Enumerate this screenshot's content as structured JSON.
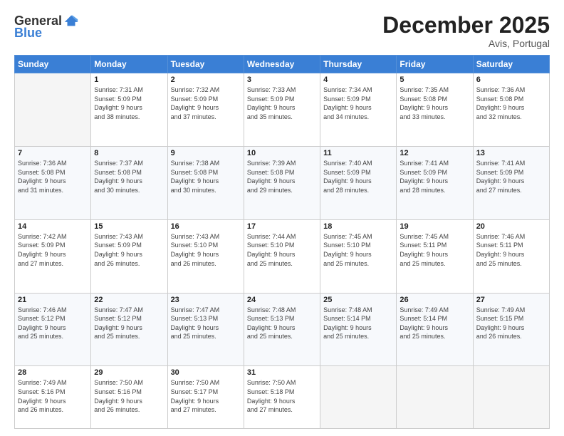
{
  "header": {
    "logo_line1": "General",
    "logo_line2": "Blue",
    "month_title": "December 2025",
    "location": "Avis, Portugal"
  },
  "days_of_week": [
    "Sunday",
    "Monday",
    "Tuesday",
    "Wednesday",
    "Thursday",
    "Friday",
    "Saturday"
  ],
  "weeks": [
    [
      {
        "day": "",
        "info": ""
      },
      {
        "day": "1",
        "info": "Sunrise: 7:31 AM\nSunset: 5:09 PM\nDaylight: 9 hours\nand 38 minutes."
      },
      {
        "day": "2",
        "info": "Sunrise: 7:32 AM\nSunset: 5:09 PM\nDaylight: 9 hours\nand 37 minutes."
      },
      {
        "day": "3",
        "info": "Sunrise: 7:33 AM\nSunset: 5:09 PM\nDaylight: 9 hours\nand 35 minutes."
      },
      {
        "day": "4",
        "info": "Sunrise: 7:34 AM\nSunset: 5:09 PM\nDaylight: 9 hours\nand 34 minutes."
      },
      {
        "day": "5",
        "info": "Sunrise: 7:35 AM\nSunset: 5:08 PM\nDaylight: 9 hours\nand 33 minutes."
      },
      {
        "day": "6",
        "info": "Sunrise: 7:36 AM\nSunset: 5:08 PM\nDaylight: 9 hours\nand 32 minutes."
      }
    ],
    [
      {
        "day": "7",
        "info": "Sunrise: 7:36 AM\nSunset: 5:08 PM\nDaylight: 9 hours\nand 31 minutes."
      },
      {
        "day": "8",
        "info": "Sunrise: 7:37 AM\nSunset: 5:08 PM\nDaylight: 9 hours\nand 30 minutes."
      },
      {
        "day": "9",
        "info": "Sunrise: 7:38 AM\nSunset: 5:08 PM\nDaylight: 9 hours\nand 30 minutes."
      },
      {
        "day": "10",
        "info": "Sunrise: 7:39 AM\nSunset: 5:08 PM\nDaylight: 9 hours\nand 29 minutes."
      },
      {
        "day": "11",
        "info": "Sunrise: 7:40 AM\nSunset: 5:09 PM\nDaylight: 9 hours\nand 28 minutes."
      },
      {
        "day": "12",
        "info": "Sunrise: 7:41 AM\nSunset: 5:09 PM\nDaylight: 9 hours\nand 28 minutes."
      },
      {
        "day": "13",
        "info": "Sunrise: 7:41 AM\nSunset: 5:09 PM\nDaylight: 9 hours\nand 27 minutes."
      }
    ],
    [
      {
        "day": "14",
        "info": "Sunrise: 7:42 AM\nSunset: 5:09 PM\nDaylight: 9 hours\nand 27 minutes."
      },
      {
        "day": "15",
        "info": "Sunrise: 7:43 AM\nSunset: 5:09 PM\nDaylight: 9 hours\nand 26 minutes."
      },
      {
        "day": "16",
        "info": "Sunrise: 7:43 AM\nSunset: 5:10 PM\nDaylight: 9 hours\nand 26 minutes."
      },
      {
        "day": "17",
        "info": "Sunrise: 7:44 AM\nSunset: 5:10 PM\nDaylight: 9 hours\nand 25 minutes."
      },
      {
        "day": "18",
        "info": "Sunrise: 7:45 AM\nSunset: 5:10 PM\nDaylight: 9 hours\nand 25 minutes."
      },
      {
        "day": "19",
        "info": "Sunrise: 7:45 AM\nSunset: 5:11 PM\nDaylight: 9 hours\nand 25 minutes."
      },
      {
        "day": "20",
        "info": "Sunrise: 7:46 AM\nSunset: 5:11 PM\nDaylight: 9 hours\nand 25 minutes."
      }
    ],
    [
      {
        "day": "21",
        "info": "Sunrise: 7:46 AM\nSunset: 5:12 PM\nDaylight: 9 hours\nand 25 minutes."
      },
      {
        "day": "22",
        "info": "Sunrise: 7:47 AM\nSunset: 5:12 PM\nDaylight: 9 hours\nand 25 minutes."
      },
      {
        "day": "23",
        "info": "Sunrise: 7:47 AM\nSunset: 5:13 PM\nDaylight: 9 hours\nand 25 minutes."
      },
      {
        "day": "24",
        "info": "Sunrise: 7:48 AM\nSunset: 5:13 PM\nDaylight: 9 hours\nand 25 minutes."
      },
      {
        "day": "25",
        "info": "Sunrise: 7:48 AM\nSunset: 5:14 PM\nDaylight: 9 hours\nand 25 minutes."
      },
      {
        "day": "26",
        "info": "Sunrise: 7:49 AM\nSunset: 5:14 PM\nDaylight: 9 hours\nand 25 minutes."
      },
      {
        "day": "27",
        "info": "Sunrise: 7:49 AM\nSunset: 5:15 PM\nDaylight: 9 hours\nand 26 minutes."
      }
    ],
    [
      {
        "day": "28",
        "info": "Sunrise: 7:49 AM\nSunset: 5:16 PM\nDaylight: 9 hours\nand 26 minutes."
      },
      {
        "day": "29",
        "info": "Sunrise: 7:50 AM\nSunset: 5:16 PM\nDaylight: 9 hours\nand 26 minutes."
      },
      {
        "day": "30",
        "info": "Sunrise: 7:50 AM\nSunset: 5:17 PM\nDaylight: 9 hours\nand 27 minutes."
      },
      {
        "day": "31",
        "info": "Sunrise: 7:50 AM\nSunset: 5:18 PM\nDaylight: 9 hours\nand 27 minutes."
      },
      {
        "day": "",
        "info": ""
      },
      {
        "day": "",
        "info": ""
      },
      {
        "day": "",
        "info": ""
      }
    ]
  ]
}
